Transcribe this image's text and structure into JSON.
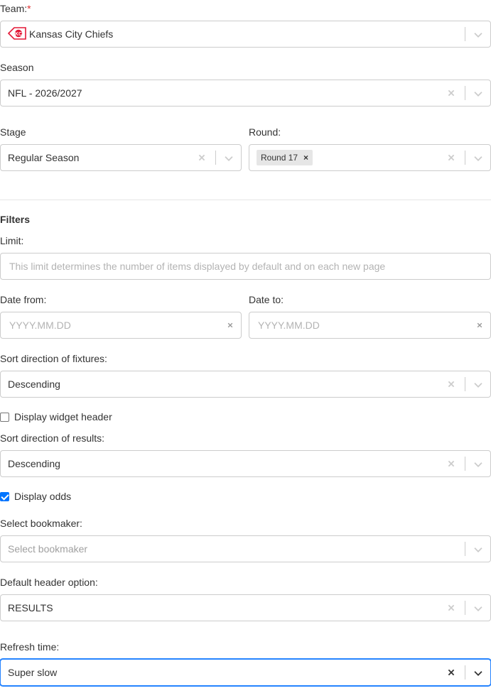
{
  "team": {
    "label": "Team:",
    "required_mark": "*",
    "value": "Kansas City Chiefs",
    "logo_icon": "chiefs-arrowhead-logo"
  },
  "season": {
    "label": "Season",
    "value": "NFL - 2026/2027"
  },
  "stage": {
    "label": "Stage",
    "value": "Regular Season"
  },
  "round": {
    "label": "Round:",
    "chips": [
      "Round 17"
    ]
  },
  "filters": {
    "heading": "Filters",
    "limit": {
      "label": "Limit:",
      "placeholder": "This limit determines the number of items displayed by default and on each new page"
    },
    "date_from": {
      "label": "Date from:",
      "placeholder": "YYYY.MM.DD"
    },
    "date_to": {
      "label": "Date to:",
      "placeholder": "YYYY.MM.DD"
    },
    "sort_fixtures": {
      "label": "Sort direction of fixtures:",
      "value": "Descending"
    },
    "display_widget_header": {
      "label": "Display widget header",
      "checked": false
    },
    "sort_results": {
      "label": "Sort direction of results:",
      "value": "Descending"
    },
    "display_odds": {
      "label": "Display odds",
      "checked": true
    },
    "bookmaker": {
      "label": "Select bookmaker:",
      "placeholder": "Select bookmaker"
    },
    "default_header": {
      "label": "Default header option:",
      "value": "RESULTS"
    },
    "refresh_time": {
      "label": "Refresh time:",
      "value": "Super slow"
    }
  },
  "colors": {
    "focus": "#2684ff",
    "required": "#e03131",
    "checkbox": "#0075ff",
    "chiefs_red": "#e31837"
  }
}
